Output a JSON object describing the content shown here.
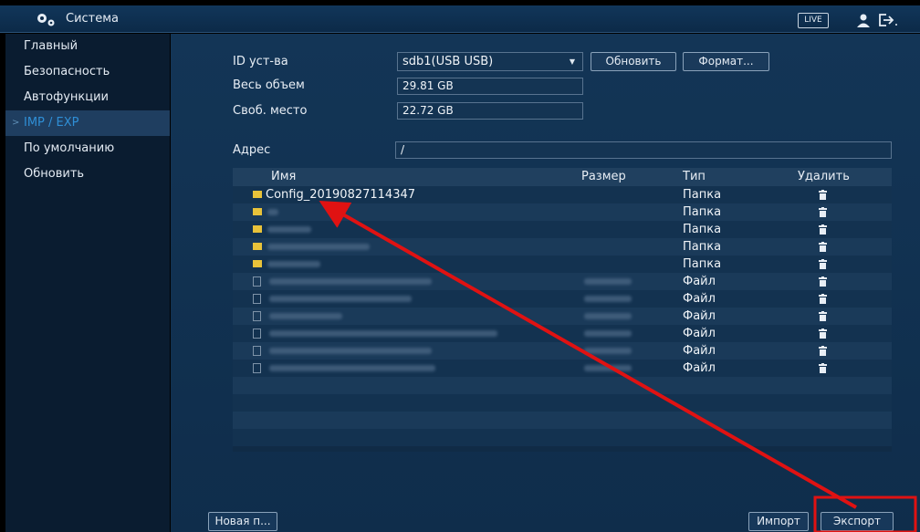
{
  "header": {
    "title": "Система",
    "live_label": "LIVE"
  },
  "sidebar": {
    "items": [
      {
        "label": "Главный",
        "active": false
      },
      {
        "label": "Безопасность",
        "active": false
      },
      {
        "label": "Автофункции",
        "active": false
      },
      {
        "label": "IMP / EXP",
        "active": true
      },
      {
        "label": "По умолчанию",
        "active": false
      },
      {
        "label": "Обновить",
        "active": false
      }
    ]
  },
  "form": {
    "device_label": "ID уст-ва",
    "device_value": "sdb1(USB USB)",
    "refresh_label": "Обновить",
    "format_label": "Формат...",
    "total_label": "Весь объем",
    "total_value": "29.81 GB",
    "free_label": "Своб. место",
    "free_value": "22.72 GB",
    "address_label": "Адрес",
    "address_value": "/"
  },
  "table": {
    "columns": [
      "Имя",
      "Размер",
      "Тип",
      "Удалить"
    ],
    "rows": [
      {
        "name": "Config_20190827114347",
        "type": "Папка",
        "kind": "folder"
      },
      {
        "name": "",
        "type": "Папка",
        "kind": "folder"
      },
      {
        "name": "",
        "type": "Папка",
        "kind": "folder"
      },
      {
        "name": "",
        "type": "Папка",
        "kind": "folder"
      },
      {
        "name": "",
        "type": "Папка",
        "kind": "folder"
      },
      {
        "name": "",
        "type": "Файл",
        "kind": "file"
      },
      {
        "name": "",
        "type": "Файл",
        "kind": "file"
      },
      {
        "name": "",
        "type": "Файл",
        "kind": "file"
      },
      {
        "name": "",
        "type": "Файл",
        "kind": "file"
      },
      {
        "name": "",
        "type": "Файл",
        "kind": "file"
      },
      {
        "name": "",
        "type": "Файл",
        "kind": "file"
      }
    ]
  },
  "footer": {
    "new_folder_label": "Новая п...",
    "import_label": "Импорт",
    "export_label": "Экспорт"
  },
  "colors": {
    "accent_active": "#2f8fd6",
    "annotation_red": "#e01212",
    "folder_yellow": "#e8c23a"
  },
  "icons": [
    "gear-icon",
    "user-icon",
    "logout-icon",
    "folder-icon",
    "file-icon",
    "trash-icon"
  ]
}
